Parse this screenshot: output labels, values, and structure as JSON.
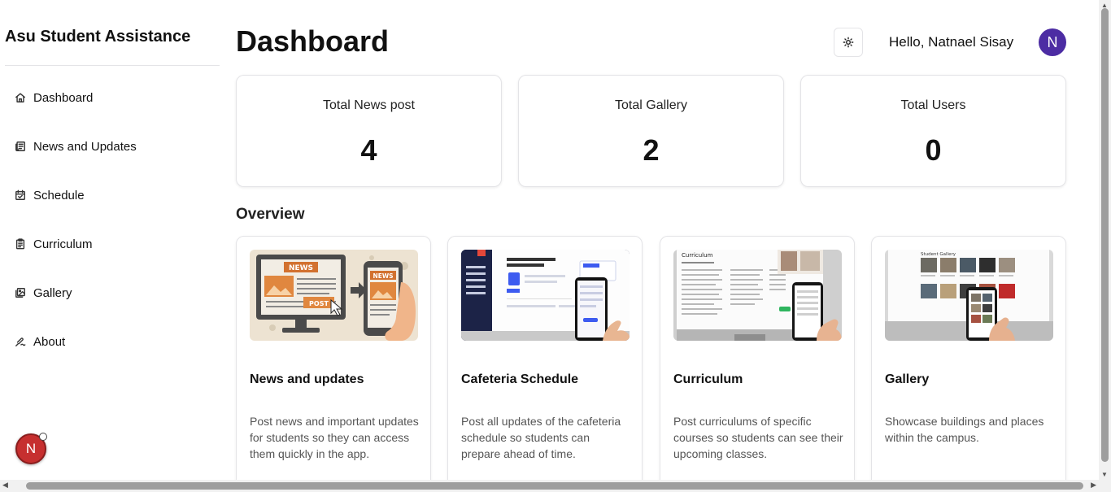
{
  "sidebar": {
    "brand": "Asu Student Assistance",
    "items": [
      {
        "label": "Dashboard",
        "icon": "home-icon"
      },
      {
        "label": "News and Updates",
        "icon": "newspaper-icon"
      },
      {
        "label": "Schedule",
        "icon": "calendar-icon"
      },
      {
        "label": "Curriculum",
        "icon": "clipboard-icon"
      },
      {
        "label": "Gallery",
        "icon": "images-icon"
      },
      {
        "label": "About",
        "icon": "signature-icon"
      }
    ],
    "fab_initial": "N"
  },
  "header": {
    "title": "Dashboard",
    "theme_icon": "sun-icon",
    "greeting": "Hello, Natnael Sisay",
    "avatar_initial": "N"
  },
  "stats": [
    {
      "label": "Total News post",
      "value": "4"
    },
    {
      "label": "Total Gallery",
      "value": "2"
    },
    {
      "label": "Total Users",
      "value": "0"
    }
  ],
  "overview": {
    "title": "Overview",
    "cards": [
      {
        "title": "News and updates",
        "description": "Post news and important updates for students so they can access them quickly in the app."
      },
      {
        "title": "Cafeteria Schedule",
        "description": "Post all updates of the cafeteria schedule so students can prepare ahead of time."
      },
      {
        "title": "Curriculum",
        "description": "Post curriculums of specific courses so students can see their upcoming classes."
      },
      {
        "title": "Gallery",
        "description": "Showcase buildings and places within the campus."
      }
    ],
    "thumb_text": {
      "news_word": "NEWS",
      "post_word": "POST",
      "curriculum_word": "Curriculum",
      "gallery_word": "Student Gallery"
    }
  },
  "colors": {
    "accent_avatar": "#4c2ca3",
    "fab": "#c62f2f",
    "border": "#e4e4e7"
  }
}
